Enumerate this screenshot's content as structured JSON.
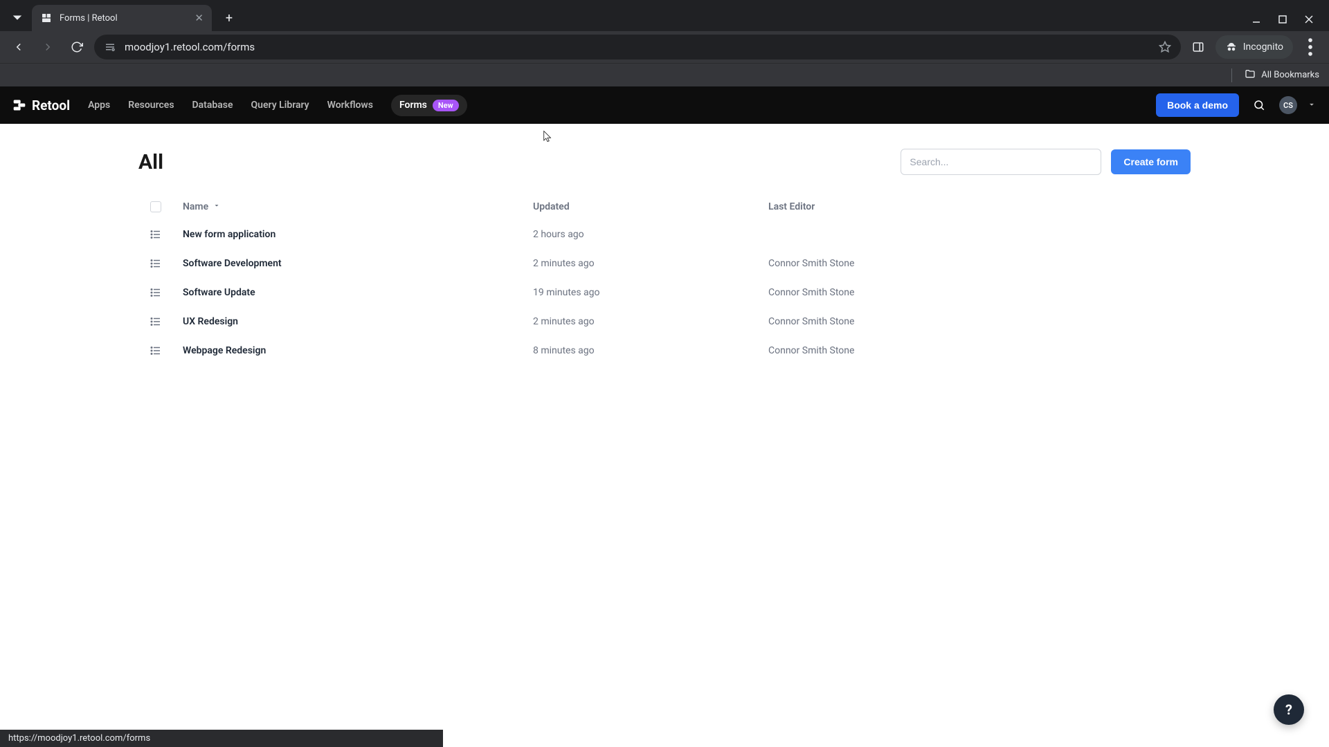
{
  "browser": {
    "tab_title": "Forms | Retool",
    "url": "moodjoy1.retool.com/forms",
    "incognito_label": "Incognito",
    "all_bookmarks": "All Bookmarks",
    "status_url": "https://moodjoy1.retool.com/forms"
  },
  "header": {
    "brand": "Retool",
    "nav": {
      "apps": "Apps",
      "resources": "Resources",
      "database": "Database",
      "query_library": "Query Library",
      "workflows": "Workflows",
      "forms": "Forms",
      "new_badge": "New"
    },
    "demo_button": "Book a demo",
    "avatar_initials": "CS"
  },
  "page": {
    "title": "All",
    "search_placeholder": "Search...",
    "create_button": "Create form",
    "columns": {
      "name": "Name",
      "updated": "Updated",
      "last_editor": "Last Editor"
    },
    "rows": [
      {
        "name": "New form application",
        "updated": "2 hours ago",
        "editor": ""
      },
      {
        "name": "Software Development",
        "updated": "2 minutes ago",
        "editor": "Connor Smith Stone"
      },
      {
        "name": "Software Update",
        "updated": "19 minutes ago",
        "editor": "Connor Smith Stone"
      },
      {
        "name": "UX Redesign",
        "updated": "2 minutes ago",
        "editor": "Connor Smith Stone"
      },
      {
        "name": "Webpage Redesign",
        "updated": "8 minutes ago",
        "editor": "Connor Smith Stone"
      }
    ]
  },
  "help_fab": "?"
}
